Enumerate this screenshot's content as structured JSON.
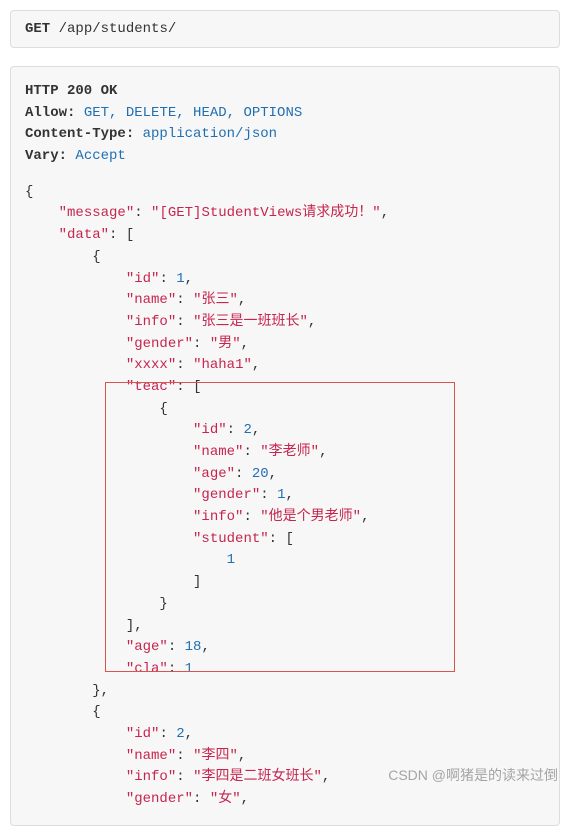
{
  "request": {
    "method": "GET",
    "path": "/app/students/"
  },
  "response": {
    "status_line": "HTTP 200 OK",
    "headers": {
      "allow_label": "Allow:",
      "allow_value": "GET, DELETE, HEAD, OPTIONS",
      "content_type_label": "Content-Type:",
      "content_type_value": "application/json",
      "vary_label": "Vary:",
      "vary_value": "Accept"
    }
  },
  "json_body": {
    "message_key": "\"message\"",
    "message_val": "\"[GET]StudentViews请求成功！\"",
    "data_key": "\"data\"",
    "s1": {
      "id_k": "\"id\"",
      "id_v": "1",
      "name_k": "\"name\"",
      "name_v": "\"张三\"",
      "info_k": "\"info\"",
      "info_v": "\"张三是一班班长\"",
      "gender_k": "\"gender\"",
      "gender_v": "\"男\"",
      "xxxx_k": "\"xxxx\"",
      "xxxx_v": "\"haha1\"",
      "teac_k": "\"teac\"",
      "teac": {
        "id_k": "\"id\"",
        "id_v": "2",
        "name_k": "\"name\"",
        "name_v": "\"李老师\"",
        "age_k": "\"age\"",
        "age_v": "20",
        "gender_k": "\"gender\"",
        "gender_v": "1",
        "info_k": "\"info\"",
        "info_v": "\"他是个男老师\"",
        "student_k": "\"student\"",
        "student_v0": "1"
      },
      "age_k": "\"age\"",
      "age_v": "18",
      "cla_k": "\"cla\"",
      "cla_v": "1"
    },
    "s2": {
      "id_k": "\"id\"",
      "id_v": "2",
      "name_k": "\"name\"",
      "name_v": "\"李四\"",
      "info_k": "\"info\"",
      "info_v": "\"李四是二班女班长\"",
      "gender_k": "\"gender\"",
      "gender_v": "\"女\""
    }
  },
  "watermark": "CSDN @啊猪是的读来过倒"
}
